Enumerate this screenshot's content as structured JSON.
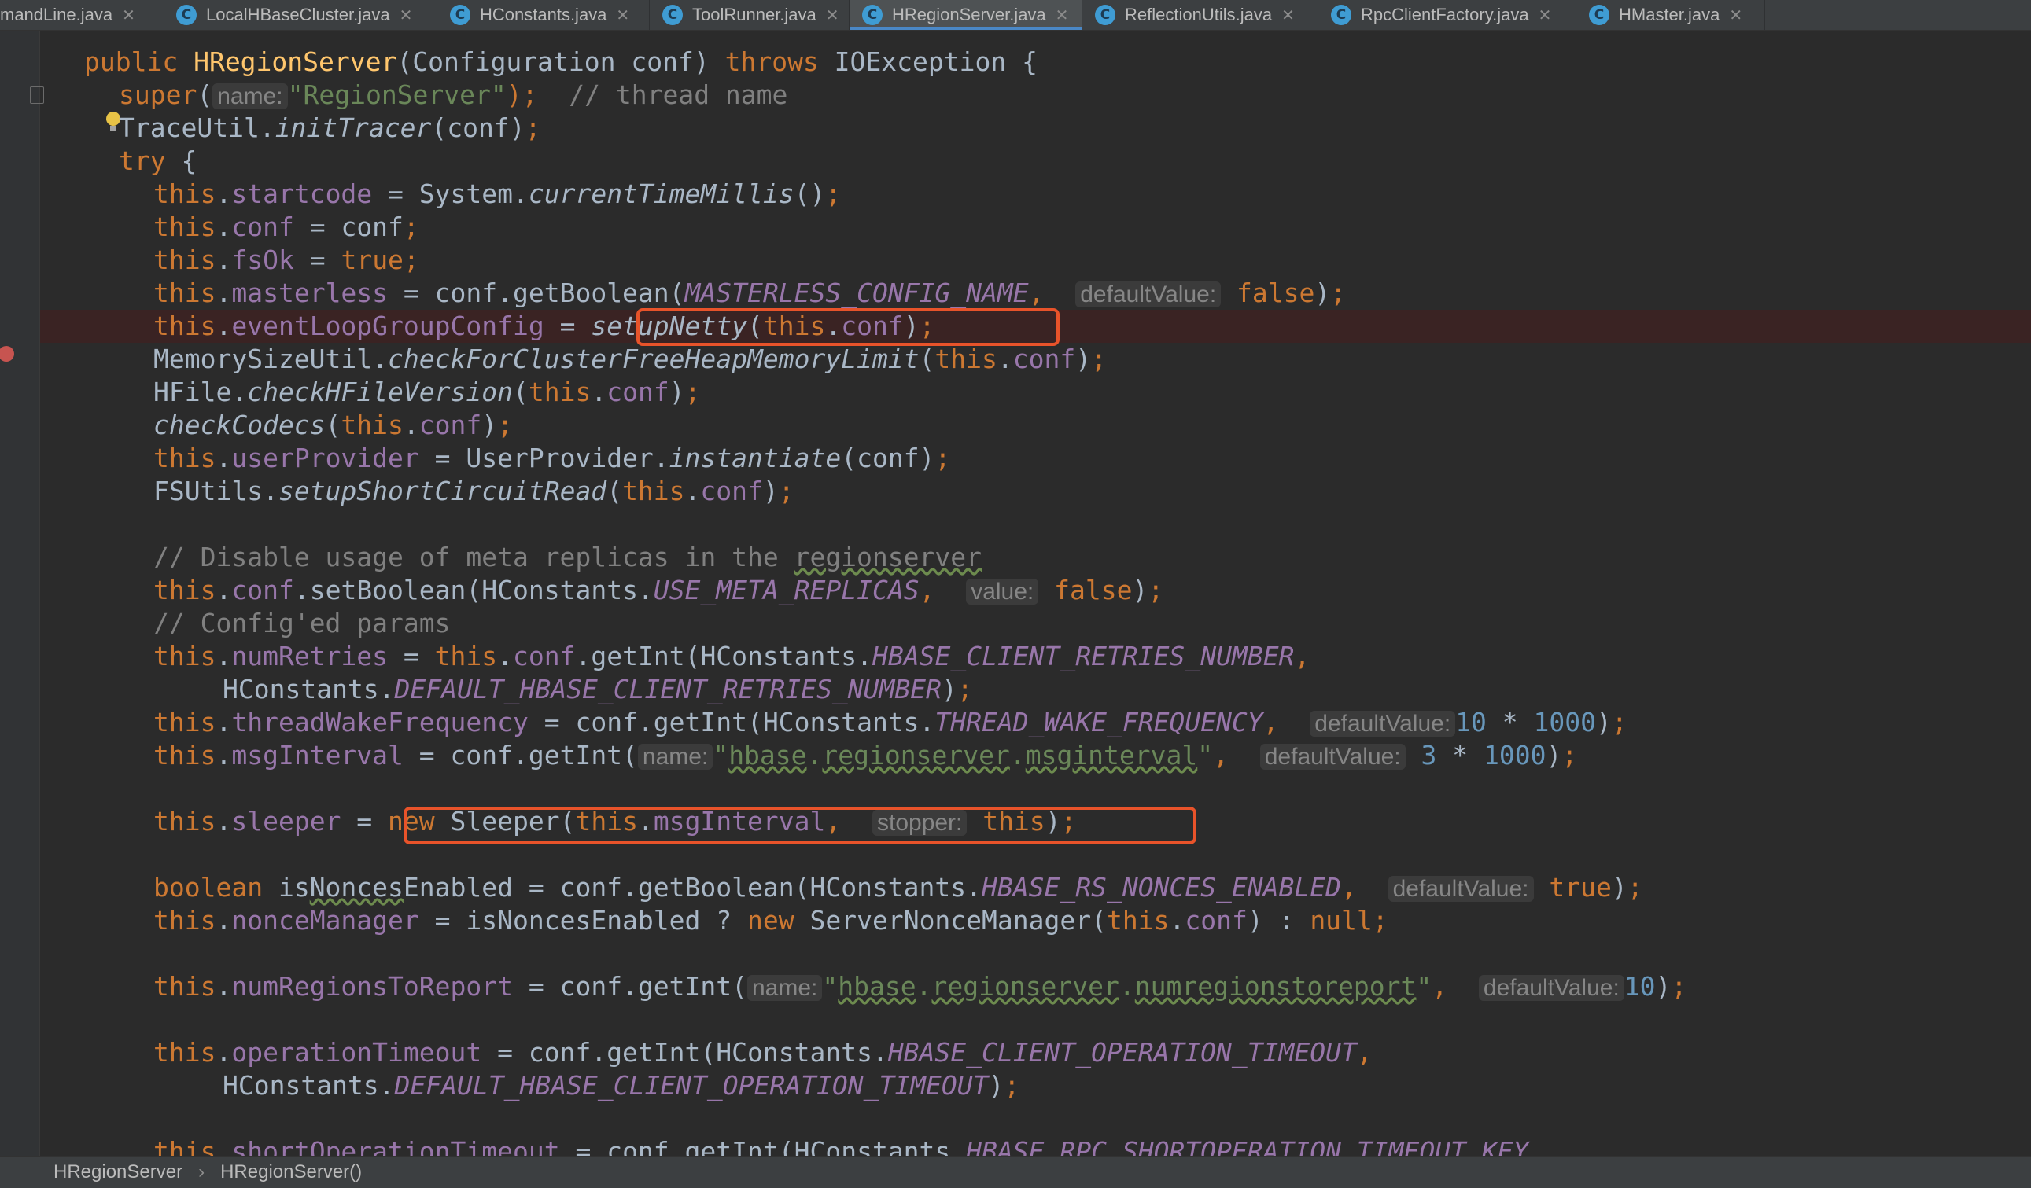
{
  "tabs": [
    {
      "label": "mandLine.java",
      "active": false
    },
    {
      "label": "LocalHBaseCluster.java",
      "active": false
    },
    {
      "label": "HConstants.java",
      "active": false
    },
    {
      "label": "ToolRunner.java",
      "active": false
    },
    {
      "label": "HRegionServer.java",
      "active": true
    },
    {
      "label": "ReflectionUtils.java",
      "active": false
    },
    {
      "label": "RpcClientFactory.java",
      "active": false
    },
    {
      "label": "HMaster.java",
      "active": false
    }
  ],
  "code": {
    "l1": {
      "a": "public ",
      "b": "HRegionServer",
      "c": "(Configuration conf) ",
      "d": "throws",
      "e": " IOException {"
    },
    "l2": {
      "a": "super",
      "b": "(",
      "h": "name:",
      "c": "\"RegionServer\"",
      "d": ");  ",
      "e": "// thread name"
    },
    "l3": {
      "a": "TraceUtil.",
      "b": "initTracer",
      "c": "(conf)",
      "d": ";"
    },
    "l4": {
      "a": "try",
      "b": " {"
    },
    "l5": {
      "a": "this",
      "b": ".",
      "c": "startcode",
      "d": " = System.",
      "e": "currentTimeMillis",
      "f": "()",
      "g": ";"
    },
    "l6": {
      "a": "this",
      "b": ".",
      "c": "conf",
      "d": " = conf",
      "e": ";"
    },
    "l7": {
      "a": "this",
      "b": ".",
      "c": "fsOk",
      "d": " = ",
      "e": "true",
      "f": ";"
    },
    "l8": {
      "a": "this",
      "b": ".",
      "c": "masterless",
      "d": " = conf.getBoolean(",
      "e": "MASTERLESS_CONFIG_NAME",
      "f": ",  ",
      "h": "defaultValue:",
      "g": "false",
      "i": ")",
      "j": ";"
    },
    "l9": {
      "a": "this",
      "b": ".",
      "c": "eventLoopGroupConfig",
      "d": " = ",
      "e": "setupNetty",
      "f": "(",
      "g": "this",
      "h": ".",
      "i": "conf",
      "j": ")",
      "k": ";"
    },
    "l10": {
      "a": "MemorySizeUtil.",
      "b": "checkForClusterFreeHeapMemoryLimit",
      "c": "(",
      "d": "this",
      "e": ".",
      "f": "conf",
      "g": ")",
      "h": ";"
    },
    "l11": {
      "a": "HFile.",
      "b": "checkHFileVersion",
      "c": "(",
      "d": "this",
      "e": ".",
      "f": "conf",
      "g": ")",
      "h": ";"
    },
    "l12": {
      "a": "checkCodecs",
      "b": "(",
      "c": "this",
      "d": ".",
      "e": "conf",
      "f": ")",
      "g": ";"
    },
    "l13": {
      "a": "this",
      "b": ".",
      "c": "userProvider",
      "d": " = UserProvider.",
      "e": "instantiate",
      "f": "(conf)",
      "g": ";"
    },
    "l14": {
      "a": "FSUtils.",
      "b": "setupShortCircuitRead",
      "c": "(",
      "d": "this",
      "e": ".",
      "f": "conf",
      "g": ")",
      "h": ";"
    },
    "l15": {
      "a": "// Disable usage of meta replicas in the ",
      "b": "regionserver"
    },
    "l16": {
      "a": "this",
      "b": ".",
      "c": "conf",
      "d": ".setBoolean(HConstants.",
      "e": "USE_META_REPLICAS",
      "f": ",  ",
      "h": "value:",
      "g": "false",
      "i": ")",
      "j": ";"
    },
    "l17": {
      "a": "// Config'ed params"
    },
    "l18": {
      "a": "this",
      "b": ".",
      "c": "numRetries",
      "d": " = ",
      "e": "this",
      "f": ".",
      "g": "conf",
      "h": ".getInt(HConstants.",
      "i": "HBASE_CLIENT_RETRIES_NUMBER",
      "j": ","
    },
    "l19": {
      "a": "HConstants.",
      "b": "DEFAULT_HBASE_CLIENT_RETRIES_NUMBER",
      "c": ")",
      "d": ";"
    },
    "l20": {
      "a": "this",
      "b": ".",
      "c": "threadWakeFrequency",
      "d": " = conf.getInt(HConstants.",
      "e": "THREAD_WAKE_FREQUENCY",
      "f": ",  ",
      "h": "defaultValue:",
      "g": "10",
      "i": " * ",
      "j": "1000",
      "k": ")",
      "l": ";"
    },
    "l21": {
      "a": "this",
      "b": ".",
      "c": "msgInterval",
      "d": " = conf.getInt(",
      "h": "name:",
      "e": "\"",
      "f": "hbase",
      "g": ".",
      "i": "regionserver",
      "j": ".",
      "k": "msginterval",
      "l": "\"",
      "m": ",  ",
      "n": "defaultValue:",
      "o": "3",
      "p": " * ",
      "q": "1000",
      "r": ")",
      "s": ";"
    },
    "l22": {
      "a": "this",
      "b": ".",
      "c": "sleeper",
      "d": " = ",
      "e": "new",
      "f": " Sleeper(",
      "g": "this",
      "h": ".",
      "i": "msgInterval",
      "j": ",  ",
      "k": "stopper:",
      "l": "this",
      "m": ")",
      "n": ";"
    },
    "l23": {
      "a": "boolean",
      "b": " is",
      "c": "Nonces",
      "d": "Enabled = conf.getBoolean(HConstants.",
      "e": "HBASE_RS_NONCES_ENABLED",
      "f": ",  ",
      "h": "defaultValue:",
      "g": "true",
      "i": ")",
      "j": ";"
    },
    "l24": {
      "a": "this",
      "b": ".",
      "c": "nonceManager",
      "d": " = isNoncesEnabled ? ",
      "e": "new",
      "f": " ServerNonceManager(",
      "g": "this",
      "h": ".",
      "i": "conf",
      "j": ") : ",
      "k": "null",
      "l": ";"
    },
    "l25": {
      "a": "this",
      "b": ".",
      "c": "numRegionsToReport",
      "d": " = conf.getInt(",
      "h": "name:",
      "e": "\"",
      "f": "hbase",
      "g": ".",
      "i": "regionserver",
      "j": ".",
      "k": "numregionstoreport",
      "l": "\"",
      "m": ",  ",
      "n": "defaultValue:",
      "o": "10",
      "p": ")",
      "q": ";"
    },
    "l26": {
      "a": "this",
      "b": ".",
      "c": "operationTimeout",
      "d": " = conf.getInt(HConstants.",
      "e": "HBASE_CLIENT_OPERATION_TIMEOUT",
      "f": ","
    },
    "l27": {
      "a": "HConstants.",
      "b": "DEFAULT_HBASE_CLIENT_OPERATION_TIMEOUT",
      "c": ")",
      "d": ";"
    },
    "l28": {
      "a": "this",
      "b": ".",
      "c": "shortOperationTimeout",
      "d": " = conf.getInt(HConstants.",
      "e": "HBASE_RPC_SHORTOPERATION_TIMEOUT_KEY"
    }
  },
  "breadcrumb": {
    "class_name": "HRegionServer",
    "method_name": "HRegionServer()",
    "separator": "›"
  },
  "colors": {
    "background": "#2b2b2b",
    "keyword": "#cc7832",
    "field": "#9876aa",
    "string": "#6a8759",
    "number": "#6897bb",
    "comment": "#808080",
    "highlight_box": "#e8532a",
    "breakpoint": "#c75450",
    "active_tab_underline": "#4a88c7"
  }
}
